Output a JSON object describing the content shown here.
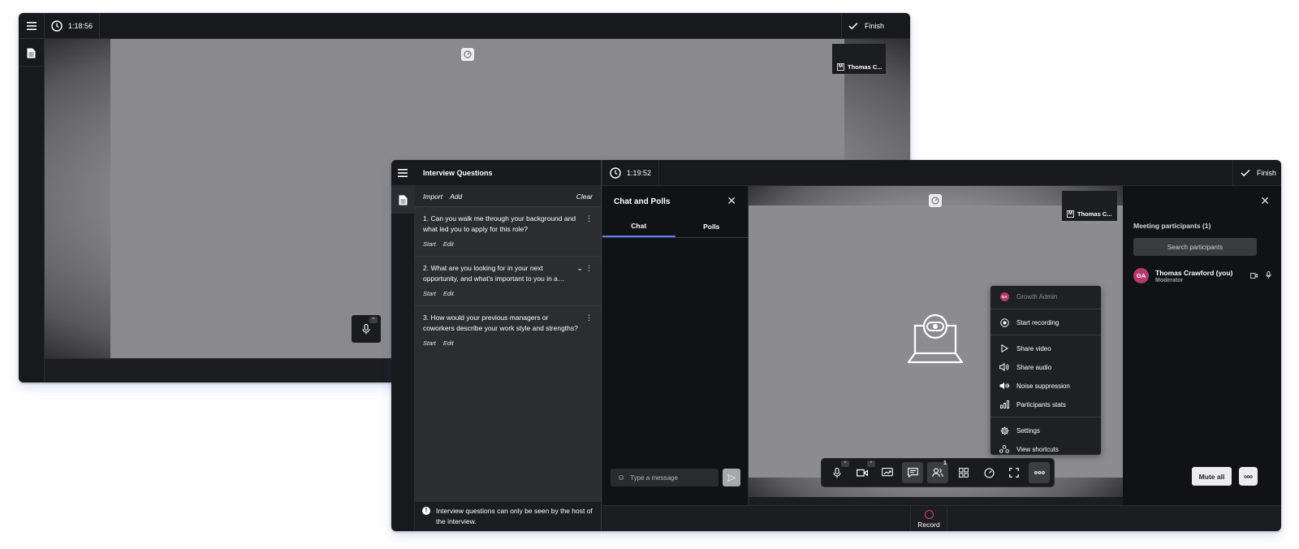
{
  "back_window": {
    "timer": "1:18:56",
    "finish_label": "Finish",
    "thumbnail_name": "Thomas C...",
    "thumbnail_badge": "M"
  },
  "front_window": {
    "timer": "1:19:52",
    "finish_label": "Finish",
    "interview_questions": {
      "title": "Interview Questions",
      "actions": {
        "import": "Import",
        "add": "Add",
        "clear": "Clear"
      },
      "items": [
        {
          "text": "1. Can you walk me through your background and what led you to apply for this role?",
          "start": "Start",
          "edit": "Edit"
        },
        {
          "text": "2. What are you looking for in your next opportunity, and what's important to you in a…",
          "start": "Start",
          "edit": "Edit"
        },
        {
          "text": "3. How would your previous managers or coworkers describe your work style and strengths?",
          "start": "Start",
          "edit": "Edit"
        }
      ],
      "footer_note": "Interview questions can only be seen by the host of the interview."
    },
    "chat": {
      "title": "Chat and Polls",
      "tabs": [
        "Chat",
        "Polls"
      ],
      "input_placeholder": "Type a message"
    },
    "video": {
      "thumbnail_name": "Thomas C...",
      "thumbnail_badge": "M"
    },
    "participants": {
      "title": "Meeting participants (1)",
      "search_placeholder": "Search participants",
      "list": [
        {
          "initials": "GA",
          "name": "Thomas Crawford (you)",
          "role": "Moderator"
        }
      ],
      "mute_all_label": "Mute all"
    },
    "more_menu": {
      "header_initials": "GA",
      "header_name": "Growth Admin",
      "items": [
        "Start recording",
        "Share video",
        "Share audio",
        "Noise suppression",
        "Participants stats",
        "Settings",
        "View shortcuts"
      ]
    },
    "toolbar": {
      "participants_count": "1"
    },
    "record_label": "Record"
  },
  "colors": {
    "accent": "#5b7cfa",
    "record": "#e5484d",
    "avatar": "#b7386f"
  }
}
